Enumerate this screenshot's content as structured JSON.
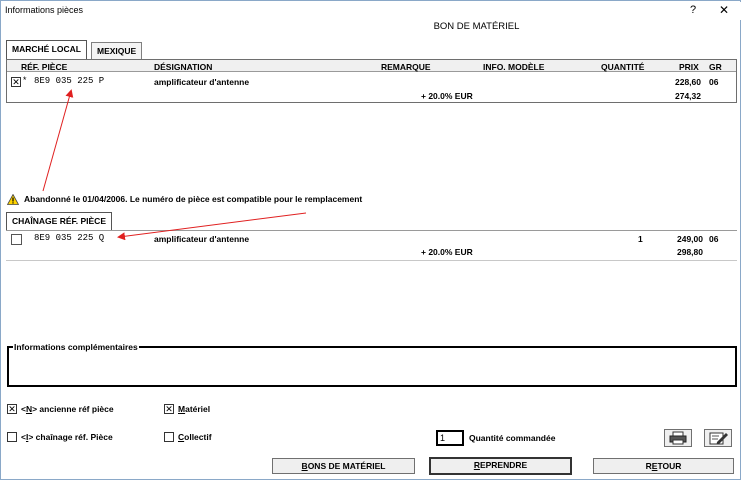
{
  "window": {
    "title": "Informations pièces",
    "help_label": "?",
    "close_label": "✕",
    "form_title": "BON DE MATÉRIEL"
  },
  "tabs": [
    {
      "label": "MARCHÉ LOCAL"
    },
    {
      "label": "MEXIQUE"
    }
  ],
  "columns": {
    "ref": "RÉF. PIÈCE",
    "designation": "DÉSIGNATION",
    "remarque": "REMARQUE",
    "info_modele": "INFO. MODÈLE",
    "quantite": "QUANTITÉ",
    "prix": "PRIX",
    "gr": "GR"
  },
  "main_row": {
    "checked_mark": "✕",
    "star": "*",
    "ref": "8E9 035 225 P",
    "designation": "amplificateur d'antenne",
    "price": "228,60",
    "gr": "06",
    "tax_label": "+ 20.0% EUR",
    "tax_price": "274,32"
  },
  "warning": {
    "text": "Abandonné le 01/04/2006. Le numéro de pièce est compatible pour le remplacement"
  },
  "chain_tab": {
    "label": "CHAÎNAGE RÉF. PIÈCE"
  },
  "chain_row": {
    "ref": "8E9 035 225 Q",
    "designation": "amplificateur d'antenne",
    "quantity": "1",
    "price": "249,00",
    "gr": "06",
    "tax_label": "+ 20.0% EUR",
    "tax_price": "298,80"
  },
  "info_section": {
    "label": "Informations complémentaires"
  },
  "options": {
    "ancienne_ref": {
      "pre": "<",
      "key": "N",
      "post": "> ancienne réf pièce",
      "checked": true
    },
    "chainage": {
      "pre": "<",
      "key": "I",
      "post": "> chaînage réf. Pièce",
      "checked": false
    },
    "materiel": {
      "key": "M",
      "post": "atériel",
      "checked": true
    },
    "collectif": {
      "key": "C",
      "post": "ollectif",
      "checked": false
    }
  },
  "quantity": {
    "value": "1",
    "label": "Quantité commandée"
  },
  "buttons": {
    "bons": {
      "pre": "",
      "key": "B",
      "post": "ONS DE MATÉRIEL"
    },
    "reprendre": {
      "pre": "",
      "key": "R",
      "post": "EPRENDRE"
    },
    "retour": {
      "pre": "R",
      "key": "E",
      "post": "TOUR"
    }
  },
  "icons": [
    "printer-icon",
    "edit-icon",
    "warning-icon"
  ],
  "colors": {
    "annotation_arrow": "#e02020",
    "border": "#6e6e6e"
  }
}
